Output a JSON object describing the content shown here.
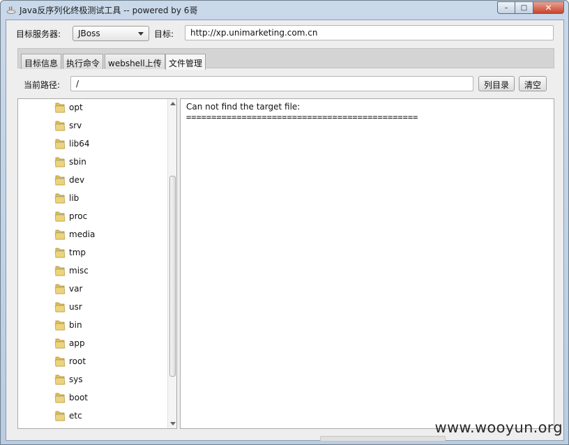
{
  "window": {
    "title": "Java反序列化终极测试工具  -- powered by 6哥",
    "minimize_glyph": "–",
    "maximize_glyph": "□",
    "close_glyph": "✕"
  },
  "top": {
    "server_label": "目标服务器:",
    "server_value": "JBoss",
    "target_label": "目标:",
    "target_value": "http://xp.unimarketing.com.cn"
  },
  "tabs": [
    {
      "label": "目标信息"
    },
    {
      "label": "执行命令"
    },
    {
      "label": "webshell上传"
    },
    {
      "label": "文件管理"
    }
  ],
  "path": {
    "label": "当前路径:",
    "value": "/",
    "list_button": "列目录",
    "clear_button": "清空"
  },
  "tree": {
    "items": [
      {
        "name": "opt"
      },
      {
        "name": "srv"
      },
      {
        "name": "lib64"
      },
      {
        "name": "sbin"
      },
      {
        "name": "dev"
      },
      {
        "name": "lib"
      },
      {
        "name": "proc"
      },
      {
        "name": "media"
      },
      {
        "name": "tmp"
      },
      {
        "name": "misc"
      },
      {
        "name": "var"
      },
      {
        "name": "usr"
      },
      {
        "name": "bin"
      },
      {
        "name": "app"
      },
      {
        "name": "root"
      },
      {
        "name": "sys"
      },
      {
        "name": "boot"
      },
      {
        "name": "etc"
      }
    ],
    "icon": "folder-icon"
  },
  "output": {
    "lines": [
      "Can not find the target file:",
      "=============================================="
    ]
  },
  "watermark": "www.wooyun.org",
  "colors": {
    "frame": "#b9cde2",
    "close_button": "#c7442b",
    "client_bg": "#eeeeee"
  }
}
